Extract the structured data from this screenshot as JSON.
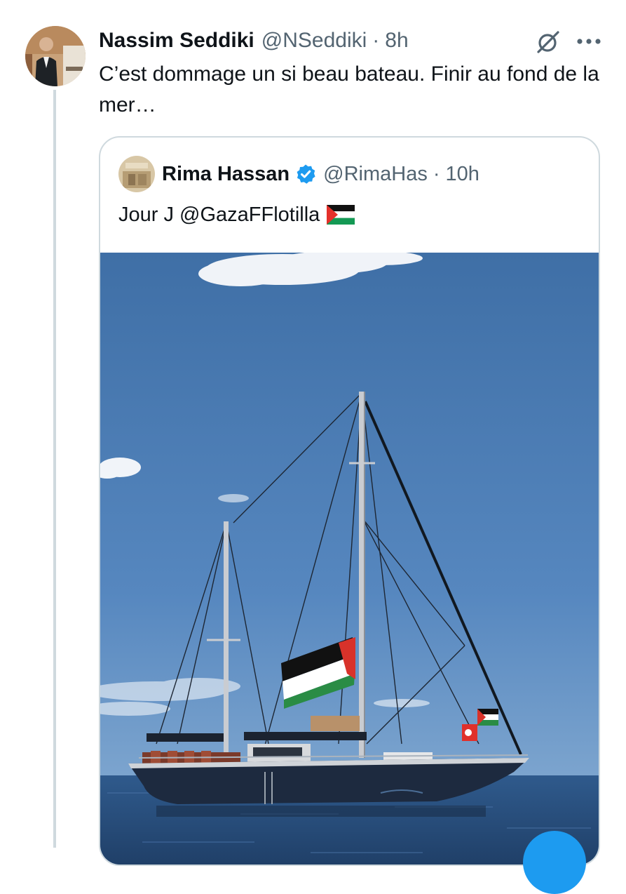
{
  "tweet": {
    "author_name": "Nassim Seddiki",
    "author_handle": "@NSeddiki",
    "separator": "·",
    "time": "8h",
    "text": "C’est dommage un si beau bateau. Finir au fond de la mer…"
  },
  "quote": {
    "author_name": "Rima Hassan",
    "author_handle": "@RimaHas",
    "separator": "·",
    "time": "10h",
    "text": "Jour J @GazaFFlotilla"
  },
  "colors": {
    "text_primary": "#0f1419",
    "text_secondary": "#536471",
    "border": "#cfd9de",
    "verified": "#1d9bf0",
    "sky": "#4f7fb5"
  },
  "icons": {
    "grok": "slashed-circle-icon",
    "more": "more-dots-icon",
    "verified": "verified-badge-icon",
    "flag": "palestine-flag-icon"
  }
}
